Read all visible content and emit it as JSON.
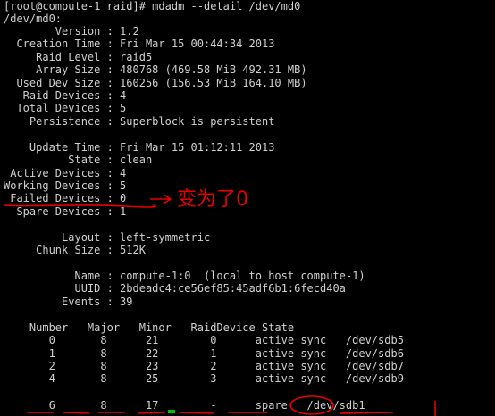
{
  "prompt": "[root@compute-1 raid]# mdadm --detail /dev/md0",
  "device": "/dev/md0:",
  "fields_top": [
    "        Version : 1.2",
    "  Creation Time : Fri Mar 15 00:44:34 2013",
    "     Raid Level : raid5",
    "     Array Size : 480768 (469.58 MiB 492.31 MB)",
    "  Used Dev Size : 160256 (156.53 MiB 164.10 MB)",
    "   Raid Devices : 4",
    "  Total Devices : 5",
    "    Persistence : Superblock is persistent"
  ],
  "fields_state": [
    "    Update Time : Fri Mar 15 01:12:11 2013",
    "          State : clean",
    " Active Devices : 4",
    "Working Devices : 5",
    " Failed Devices : 0",
    "  Spare Devices : 1"
  ],
  "fields_layout": [
    "         Layout : left-symmetric",
    "     Chunk Size : 512K"
  ],
  "fields_name": [
    "           Name : compute-1:0  (local to host compute-1)",
    "           UUID : 2bdeadc4:ce56ef85:45adf6b1:6fecd40a",
    "         Events : 39"
  ],
  "table_header": "    Number   Major   Minor   RaidDevice State",
  "table_rows": [
    "       0       8      21        0      active sync   /dev/sdb5",
    "       1       8      22        1      active sync   /dev/sdb6",
    "       2       8      23        2      active sync   /dev/sdb7",
    "       4       8      25        3      active sync   /dev/sdb9"
  ],
  "spare_row": "       6       8      17        -      spare   /dev/sdb1",
  "annotation": "变为了0",
  "colors": {
    "background": "#000000",
    "text": "#d0d0d0",
    "annotation": "#e60000",
    "cursor": "#00c000"
  }
}
